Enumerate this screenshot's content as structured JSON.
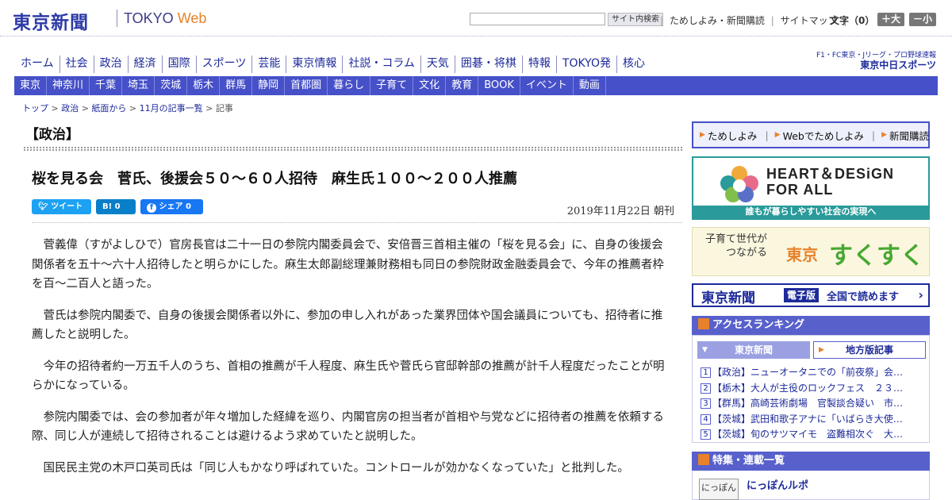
{
  "header": {
    "logo": "東京新聞",
    "tokyo": "TOKYO",
    "web": "Web",
    "search_placeholder": "",
    "search_button": "サイト内検索",
    "links": [
      "ためしよみ・新聞購読",
      "サイトマップ"
    ],
    "font_size_label": "文字（0）",
    "font_bigger": "＋大",
    "font_smaller": "－小"
  },
  "nav_main": [
    "ホーム",
    "社会",
    "政治",
    "経済",
    "国際",
    "スポーツ",
    "芸能",
    "東京情報",
    "社説・コラム",
    "天気",
    "囲碁・将棋",
    "特報",
    "TOKYO発",
    "核心"
  ],
  "chunichi": {
    "line1": "F1・FC東京・Jリーグ・プロ野球速報",
    "line2": "東京中日スポーツ"
  },
  "nav_local": [
    "東京",
    "神奈川",
    "千葉",
    "埼玉",
    "茨城",
    "栃木",
    "群馬",
    "静岡",
    "首都圏",
    "暮らし",
    "子育て",
    "文化",
    "教育",
    "BOOK",
    "イベント",
    "動画"
  ],
  "breadcrumb": {
    "items": [
      "トップ",
      "政治",
      "紙面から",
      "11月の記事一覧",
      "記事"
    ],
    "sep": " > "
  },
  "article": {
    "section": "【政治】",
    "headline": "桜を見る会　菅氏、後援会５０～６０人招待　麻生氏１００～２００人推薦",
    "tweet": "ツイート",
    "hatena": "B! 0",
    "share": "シェア 0",
    "date": "2019年11月22日 朝刊",
    "paragraphs": [
      "菅義偉（すがよしひで）官房長官は二十一日の参院内閣委員会で、安倍晋三首相主催の「桜を見る会」に、自身の後援会関係者を五十～六十人招待したと明らかにした。麻生太郎副総理兼財務相も同日の参院財政金融委員会で、今年の推薦者枠を百～二百人と語った。",
      "菅氏は参院内閣委で、自身の後援会関係者以外に、参加の申し入れがあった業界団体や国会議員についても、招待者に推薦したと説明した。",
      "今年の招待者約一万五千人のうち、首相の推薦が千人程度、麻生氏や菅氏ら官邸幹部の推薦が計千人程度だったことが明らかになっている。",
      "参院内閣委では、会の参加者が年々増加した経緯を巡り、内閣官房の担当者が首相や与党などに招待者の推薦を依頼する際、同じ人が連続して招待されることは避けるよう求めていたと説明した。",
      "国民民主党の木戸口英司氏は「同じ人もかなり呼ばれていた。コントロールが効かなくなっていた」と批判した。"
    ]
  },
  "sidebar": {
    "tameshi": [
      "ためしよみ",
      "Webでためしよみ",
      "新聞購読"
    ],
    "heart": {
      "line1": "HEART＆DESiGN",
      "line2": "FOR ALL",
      "foot": "誰もが暮らしやすい社会の実現へ"
    },
    "sukusuku": {
      "line1": "子育て世代が",
      "line2": "つながる",
      "city": "東京",
      "name": "すくすく"
    },
    "denshi": {
      "name": "東京新聞",
      "tag": "電子版",
      "text": "全国で読めます"
    },
    "ranking": {
      "title": "アクセスランキング",
      "tab1": "東京新聞",
      "tab2": "地方版記事",
      "items": [
        "【政治】ニューオータニでの「前夜祭」会…",
        "【栃木】大人が主役のロックフェス　２３…",
        "【群馬】高崎芸術劇場　官製談合疑い　市…",
        "【茨城】武田和歌子アナに「いばらき大使…",
        "【茨城】旬のサツマイモ　盗難相次ぐ　大…"
      ]
    },
    "features": {
      "title": "特集・連載一覧",
      "item": "にっぽんルポ",
      "thumb": "にっぽん"
    }
  },
  "colors": {
    "brand": "#2d3aa8",
    "nav_bar": "#4650c8",
    "accent": "#e8822a",
    "heart": "#2a9a9a"
  }
}
